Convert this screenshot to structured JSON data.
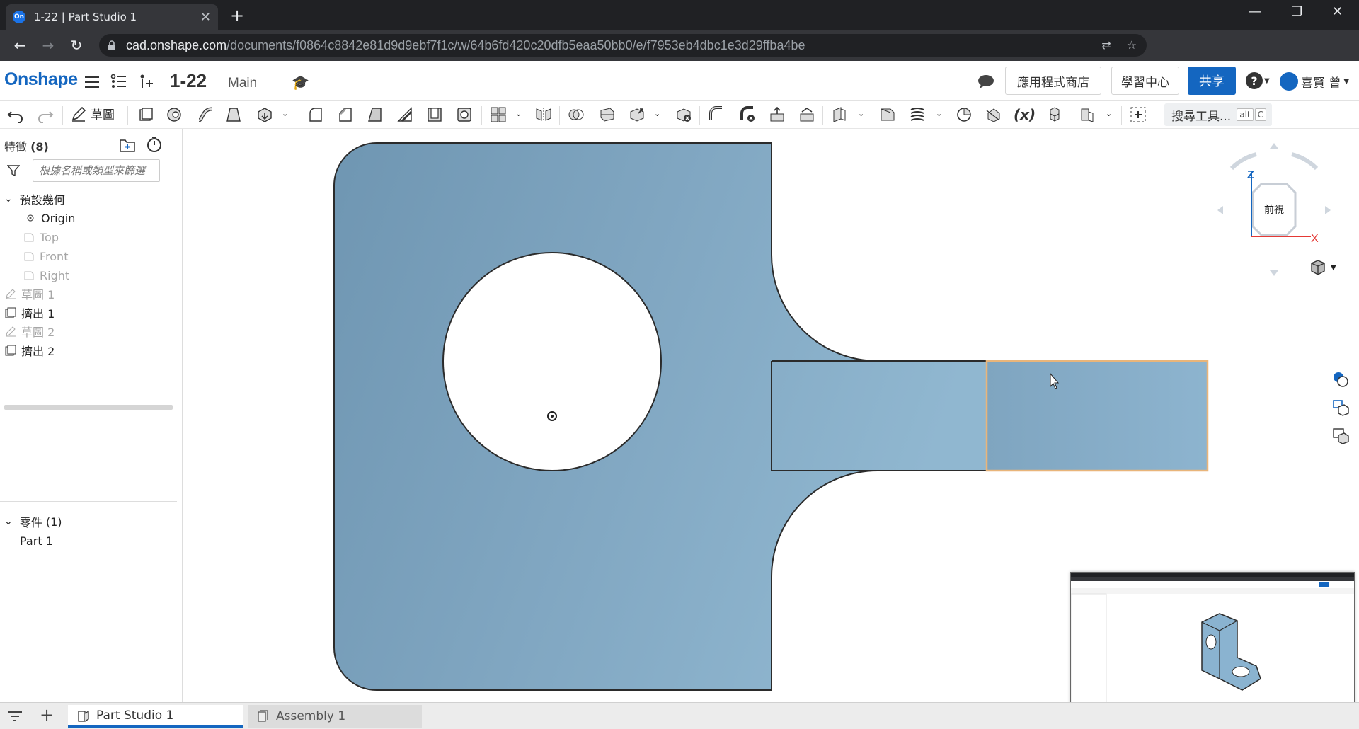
{
  "browser": {
    "tab_title": "1-22 | Part Studio 1",
    "tab_favicon": "On",
    "url_host": "cad.onshape.com",
    "url_path": "/documents/f0864c8842e81d9d9ebf7f1c/w/64b6fd420c20dfb5eaa50bb0/e/f7953eb4dbc1e3d29ffba4be",
    "profile_label": "喜賢"
  },
  "header": {
    "logo": "Onshape",
    "doc_title": "1-22",
    "branch": "Main",
    "app_store_label": "應用程式商店",
    "learning_label": "學習中心",
    "share_label": "共享",
    "user_name": "喜賢 曾"
  },
  "toolbar": {
    "sketch_label": "草圖",
    "search_tools_label": "搜尋工具...",
    "search_shortcut_1": "alt",
    "search_shortcut_2": "C"
  },
  "features": {
    "title": "特徵",
    "count": "(8)",
    "filter_placeholder": "根據名稱或類型來篩選",
    "default_geometry_label": "預設幾何",
    "items": [
      {
        "label": "Origin"
      },
      {
        "label": "Top"
      },
      {
        "label": "Front"
      },
      {
        "label": "Right"
      },
      {
        "label": "草圖 1"
      },
      {
        "label": "擠出 1"
      },
      {
        "label": "草圖 2"
      },
      {
        "label": "擠出 2"
      }
    ],
    "parts_label": "零件",
    "parts_count": "(1)",
    "parts": [
      {
        "label": "Part 1"
      }
    ]
  },
  "viewcube": {
    "face_label": "前視",
    "axis_z": "Z",
    "axis_x": "X"
  },
  "tabs": [
    {
      "label": "Part Studio 1"
    },
    {
      "label": "Assembly 1"
    }
  ],
  "colors": {
    "brand": "#1466c0",
    "part_face": "#7ea5c0",
    "selected_edge": "#f0a040"
  }
}
